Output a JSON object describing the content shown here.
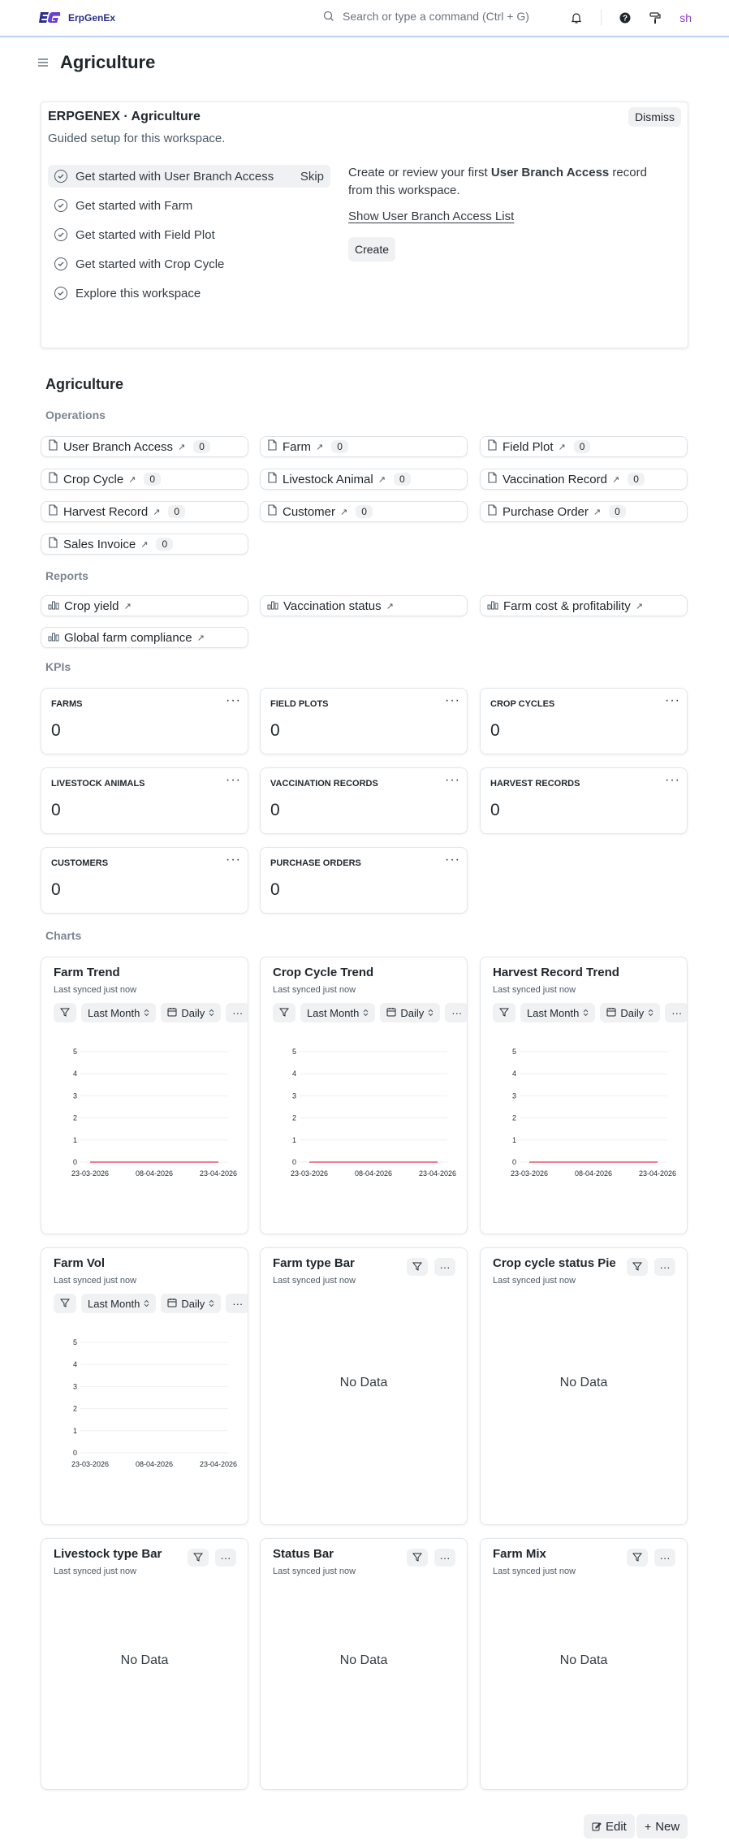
{
  "topbar": {
    "brand": "ErpGenEx",
    "search_placeholder": "Search or type a command (Ctrl + G)",
    "avatar": "sh"
  },
  "header": {
    "title": "Agriculture"
  },
  "onboarding": {
    "title": "ERPGENEX · Agriculture",
    "subtitle": "Guided setup for this workspace.",
    "dismiss": "Dismiss",
    "skip": "Skip",
    "steps": [
      {
        "label": "Get started with User Branch Access"
      },
      {
        "label": "Get started with Farm"
      },
      {
        "label": "Get started with Field Plot"
      },
      {
        "label": "Get started with Crop Cycle"
      },
      {
        "label": "Explore this workspace"
      }
    ],
    "detail_pre": "Create or review your first ",
    "detail_bold": "User Branch Access",
    "detail_post": " record from this workspace.",
    "link": "Show User Branch Access List",
    "create": "Create"
  },
  "workspace": {
    "title": "Agriculture",
    "operations_label": "Operations",
    "reports_label": "Reports",
    "kpis_label": "KPIs",
    "charts_label": "Charts"
  },
  "shortcuts": [
    {
      "label": "User Branch Access",
      "count": "0"
    },
    {
      "label": "Farm",
      "count": "0"
    },
    {
      "label": "Field Plot",
      "count": "0"
    },
    {
      "label": "Crop Cycle",
      "count": "0"
    },
    {
      "label": "Livestock Animal",
      "count": "0"
    },
    {
      "label": "Vaccination Record",
      "count": "0"
    },
    {
      "label": "Harvest Record",
      "count": "0"
    },
    {
      "label": "Customer",
      "count": "0"
    },
    {
      "label": "Purchase Order",
      "count": "0"
    },
    {
      "label": "Sales Invoice",
      "count": "0"
    }
  ],
  "reports": [
    {
      "label": "Crop yield"
    },
    {
      "label": "Vaccination status"
    },
    {
      "label": "Farm cost & profitability"
    },
    {
      "label": "Global farm compliance"
    }
  ],
  "kpis": [
    {
      "label": "FARMS",
      "value": "0"
    },
    {
      "label": "FIELD PLOTS",
      "value": "0"
    },
    {
      "label": "CROP CYCLES",
      "value": "0"
    },
    {
      "label": "LIVESTOCK ANIMALS",
      "value": "0"
    },
    {
      "label": "VACCINATION RECORDS",
      "value": "0"
    },
    {
      "label": "HARVEST RECORDS",
      "value": "0"
    },
    {
      "label": "CUSTOMERS",
      "value": "0"
    },
    {
      "label": "PURCHASE ORDERS",
      "value": "0"
    }
  ],
  "charts_common": {
    "synced": "Last synced just now",
    "range": "Last Month",
    "interval": "Daily",
    "no_data": "No Data"
  },
  "charts": [
    {
      "title": "Farm Trend"
    },
    {
      "title": "Crop Cycle Trend"
    },
    {
      "title": "Harvest Record Trend"
    },
    {
      "title": "Farm Vol"
    },
    {
      "title": "Farm type Bar"
    },
    {
      "title": "Crop cycle status Pie"
    },
    {
      "title": "Livestock type Bar"
    },
    {
      "title": "Status Bar"
    },
    {
      "title": "Farm Mix"
    }
  ],
  "chart_data": [
    {
      "type": "line",
      "x": [
        "23-03-2026",
        "08-04-2026",
        "23-04-2026"
      ],
      "series": [
        {
          "values": [
            0,
            0,
            0
          ]
        }
      ],
      "yticks": [
        0,
        1,
        2,
        3,
        4,
        5
      ],
      "ylim": [
        0,
        5
      ],
      "color": "#e5566e"
    },
    {
      "type": "line",
      "x": [
        "23-03-2026",
        "08-04-2026",
        "23-04-2026"
      ],
      "series": [
        {
          "values": [
            0,
            0,
            0
          ]
        }
      ],
      "yticks": [
        0,
        1,
        2,
        3,
        4,
        5
      ],
      "ylim": [
        0,
        5
      ],
      "color": "#e5566e"
    },
    {
      "type": "line",
      "x": [
        "23-03-2026",
        "08-04-2026",
        "23-04-2026"
      ],
      "series": [
        {
          "values": [
            0,
            0,
            0
          ]
        }
      ],
      "yticks": [
        0,
        1,
        2,
        3,
        4,
        5
      ],
      "ylim": [
        0,
        5
      ],
      "color": "#e5566e"
    },
    {
      "type": "bar",
      "x": [
        "23-03-2026",
        "08-04-2026",
        "23-04-2026"
      ],
      "series": [
        {
          "values": [
            0,
            0,
            0
          ]
        }
      ],
      "yticks": [
        0,
        1,
        2,
        3,
        4,
        5
      ],
      "ylim": [
        0,
        5
      ],
      "color": "#e5566e"
    }
  ],
  "footer": {
    "edit": "Edit",
    "new": "New"
  }
}
